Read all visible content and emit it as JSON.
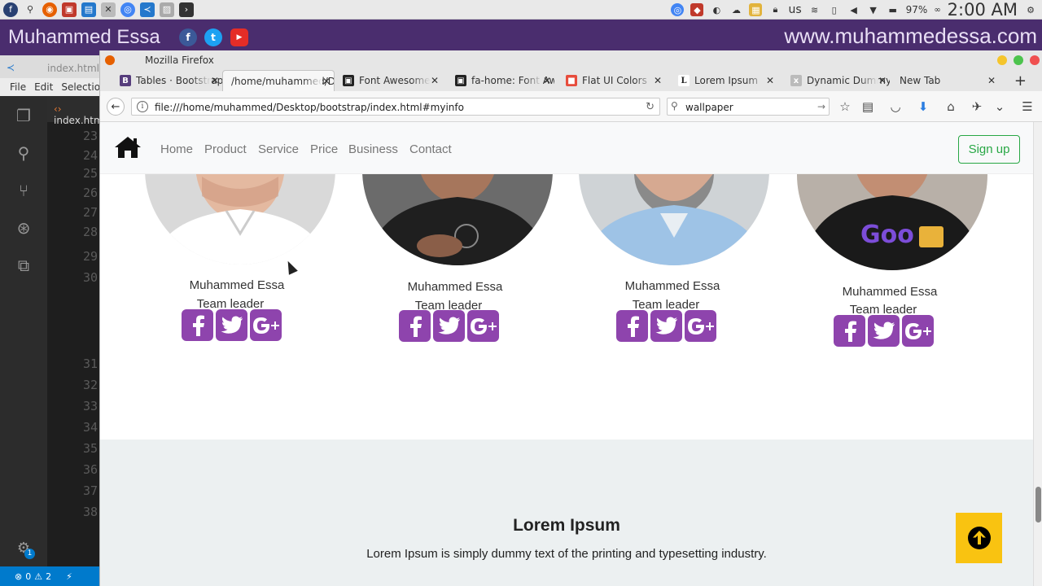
{
  "os_panel": {
    "keyboard_layout": "us",
    "battery": "97%",
    "battery_suffix": "∞",
    "clock": "2:00 AM"
  },
  "banner": {
    "name": "Muhammed Essa",
    "url": "www.muhammedessa.com",
    "social": [
      "f",
      "t",
      "▶"
    ]
  },
  "vscode": {
    "tab_title": "index.html",
    "menu": [
      "File",
      "Edit",
      "Selection"
    ],
    "editor_tab": "index.html",
    "line_numbers": [
      "23",
      "24",
      "25",
      "26",
      "27",
      "28",
      "29",
      "30",
      "31",
      "32",
      "33",
      "34",
      "35",
      "36",
      "37",
      "38"
    ],
    "status_errors": "0",
    "status_warnings": "2",
    "settings_badge": "1"
  },
  "firefox": {
    "window_title": "Mozilla Firefox",
    "tabs": [
      {
        "title": "Tables · Bootstrap",
        "favicon": "B",
        "fav_color": "#563d7c"
      },
      {
        "title": "/home/muhammed/Desktop",
        "favicon": "",
        "fav_color": "transparent"
      },
      {
        "title": "Font Awesome",
        "favicon": "▣",
        "fav_color": "#222222"
      },
      {
        "title": "fa-home: Font Awesome",
        "favicon": "▣",
        "fav_color": "#222222"
      },
      {
        "title": "Flat UI Colors",
        "favicon": "■",
        "fav_color": "#e74c3c"
      },
      {
        "title": "Lorem Ipsum",
        "favicon": "L",
        "fav_color": "#ffffff"
      },
      {
        "title": "Dynamic Dummy",
        "favicon": "x",
        "fav_color": "#bbbbbb"
      },
      {
        "title": "New Tab",
        "favicon": "",
        "fav_color": "transparent"
      }
    ],
    "url": "file:///home/muhammed/Desktop/bootstrap/index.html#myinfo",
    "search_value": "wallpaper"
  },
  "site": {
    "nav": [
      "Home",
      "Product",
      "Service",
      "Price",
      "Business",
      "Contact"
    ],
    "signup_label": "Sign up",
    "team": [
      {
        "name": "Muhammed Essa",
        "role": "Team leader",
        "shirt": "#ffffff",
        "skin": "#e4b9a0",
        "bg": "#d9d9d9"
      },
      {
        "name": "Muhammed Essa",
        "role": "Team leader",
        "shirt": "#1f1f1f",
        "skin": "#a6765c",
        "bg": "#6b6b6b"
      },
      {
        "name": "Muhammed Essa",
        "role": "Team leader",
        "shirt": "#9ec3e6",
        "skin": "#d6a991",
        "bg": "#cfd3d6"
      },
      {
        "name": "Muhammed Essa",
        "role": "Team leader",
        "shirt": "#1a1a1a",
        "skin": "#c28e73",
        "bg": "#b8b0a8"
      }
    ],
    "lorem_title": "Lorem Ipsum",
    "lorem_text": "Lorem Ipsum is simply dummy text of the printing and typesetting industry."
  },
  "colors": {
    "banner_bg": "#4a2d6e",
    "social_purple": "#8e44ad",
    "signup_green": "#28a745",
    "scroll_top_yellow": "#f9c311",
    "section_grey": "#ecf0f1"
  }
}
